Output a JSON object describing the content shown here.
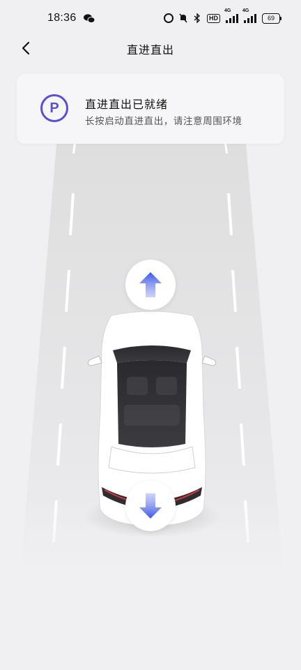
{
  "status_bar": {
    "time": "18:36",
    "battery": "69",
    "network_tag": "4G",
    "hd": "HD"
  },
  "nav": {
    "title": "直进直出",
    "back_icon": "chevron-left-icon"
  },
  "card": {
    "icon": "parking-icon",
    "icon_letter": "P",
    "title": "直进直出已就绪",
    "subtitle": "长按启动直进直出，请注意周围环境"
  },
  "controls": {
    "forward_icon": "arrow-up-icon",
    "backward_icon": "arrow-down-icon"
  },
  "colors": {
    "accent": "#5b4fd6",
    "arrow_blue": "#4a63ef",
    "background": "#f0f0f2"
  }
}
